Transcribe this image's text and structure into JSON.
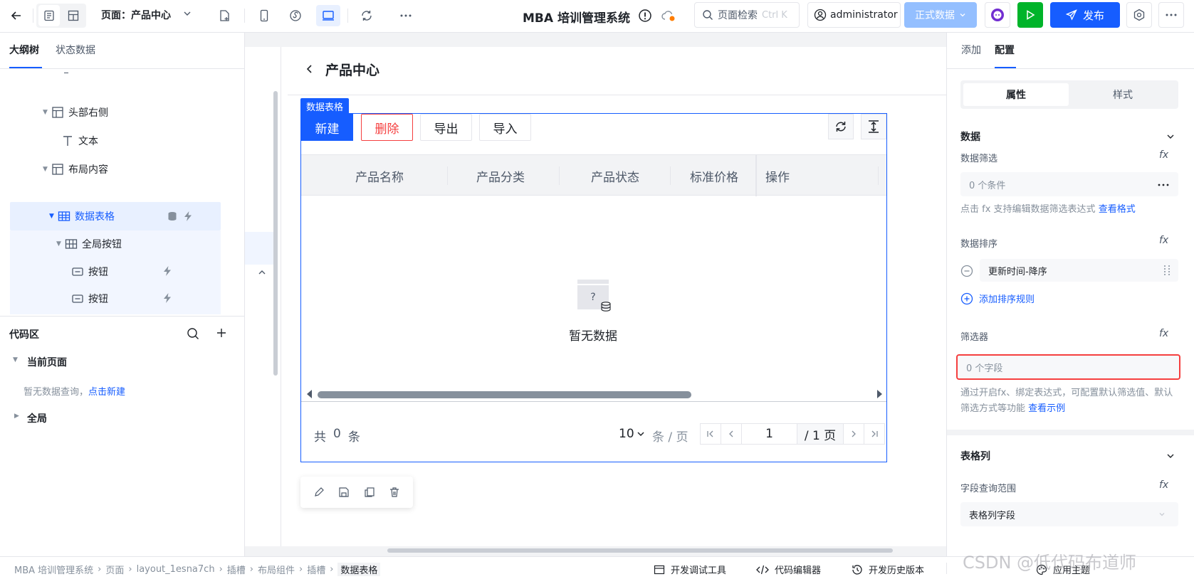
{
  "header": {
    "page_label": "页面：产品中心",
    "app_title": "MBA 培训管理系统",
    "search_placeholder": "页面检索",
    "search_shortcut": "Ctrl K",
    "user": "administrator",
    "env": "正式数据",
    "publish": "发布"
  },
  "left": {
    "tabs": [
      "大纲树",
      "状态数据"
    ],
    "tree": [
      {
        "label": "头部右侧"
      },
      {
        "label": "文本"
      },
      {
        "label": "布局内容"
      },
      {
        "label": "数据表格"
      },
      {
        "label": "全局按钮"
      },
      {
        "label": "按钮"
      },
      {
        "label": "按钮"
      }
    ],
    "code_area": {
      "title": "代码区",
      "current_page": "当前页面",
      "empty_text": "暂无数据查询，",
      "empty_link": "点击新建",
      "global": "全局"
    }
  },
  "canvas": {
    "page_title": "产品中心",
    "component_tag": "数据表格",
    "toolbar": {
      "new": "新建",
      "delete": "删除",
      "export": "导出",
      "import": "导入"
    },
    "columns": [
      "产品名称",
      "产品分类",
      "产品状态",
      "标准价格",
      "操作"
    ],
    "empty": "暂无数据",
    "empty_icon_char": "?",
    "pagination": {
      "total_prefix": "共",
      "total": "0",
      "total_suffix": "条",
      "page_size": "10",
      "per_page": "条 / 页",
      "current": "1",
      "pages": "/ 1 页"
    }
  },
  "right": {
    "tabs": [
      "添加",
      "配置"
    ],
    "seg": [
      "属性",
      "样式"
    ],
    "data_section": "数据",
    "filter_label": "数据筛选",
    "filter_value": "0 个条件",
    "filter_hint": "点击 fx 支持编辑数据筛选表达式",
    "filter_hint_link": "查看格式",
    "sort_label": "数据排序",
    "sort_value": "更新时间-降序",
    "add_sort": "添加排序规则",
    "filterer_label": "筛选器",
    "filterer_value": "0 个字段",
    "filterer_hint": "通过开启fx、绑定表达式，可配置默认筛选值、默认筛选方式等功能",
    "filterer_hint_link": "查看示例",
    "columns_section": "表格列",
    "field_scope_label": "字段查询范围",
    "field_scope_value": "表格列字段",
    "fx": "fx"
  },
  "footer": {
    "breadcrumb": [
      "MBA 培训管理系统",
      "页面",
      "layout_1esna7ch",
      "插槽",
      "布局组件",
      "插槽",
      "数据表格"
    ],
    "dev_tools": "开发调试工具",
    "code_editor": "代码编辑器",
    "history": "开发历史版本",
    "theme": "应用主题",
    "watermark": "CSDN @低代码布道师"
  },
  "colors": {
    "primary": "#165dff",
    "danger": "#f53f3f",
    "selected_bg": "#e8f0ff",
    "env_bg": "#94bfff",
    "run_green": "#00b42a"
  }
}
